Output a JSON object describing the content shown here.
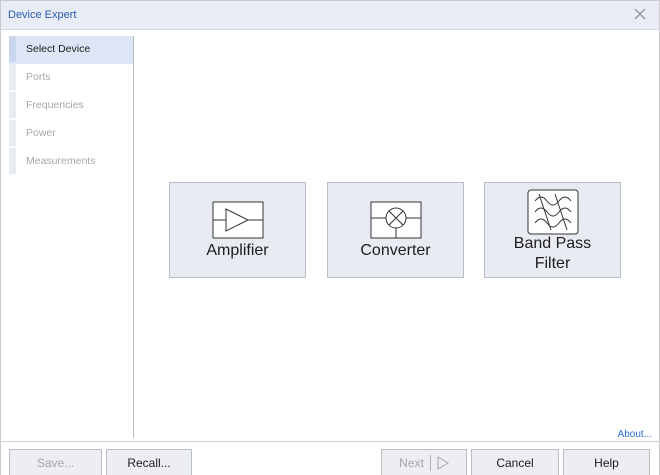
{
  "window": {
    "title": "Device Expert"
  },
  "steps": [
    {
      "label": "Select Device",
      "active": true
    },
    {
      "label": "Ports",
      "active": false
    },
    {
      "label": "Frequencies",
      "active": false
    },
    {
      "label": "Power",
      "active": false
    },
    {
      "label": "Measurements",
      "active": false
    }
  ],
  "devices": {
    "amplifier": {
      "label": "Amplifier",
      "icon": "amplifier-icon"
    },
    "converter": {
      "label": "Converter",
      "icon": "mixer-icon"
    },
    "band_pass_filter": {
      "label_line1": "Band Pass",
      "label_line2": "Filter",
      "icon": "band-pass-filter-icon"
    }
  },
  "links": {
    "about": "About..."
  },
  "footer": {
    "save": "Save...",
    "recall": "Recall...",
    "next": "Next",
    "cancel": "Cancel",
    "help": "Help"
  },
  "colors": {
    "title": "#2a5db0",
    "link": "#2a6bd0",
    "button_bg": "#e8ebf1"
  }
}
